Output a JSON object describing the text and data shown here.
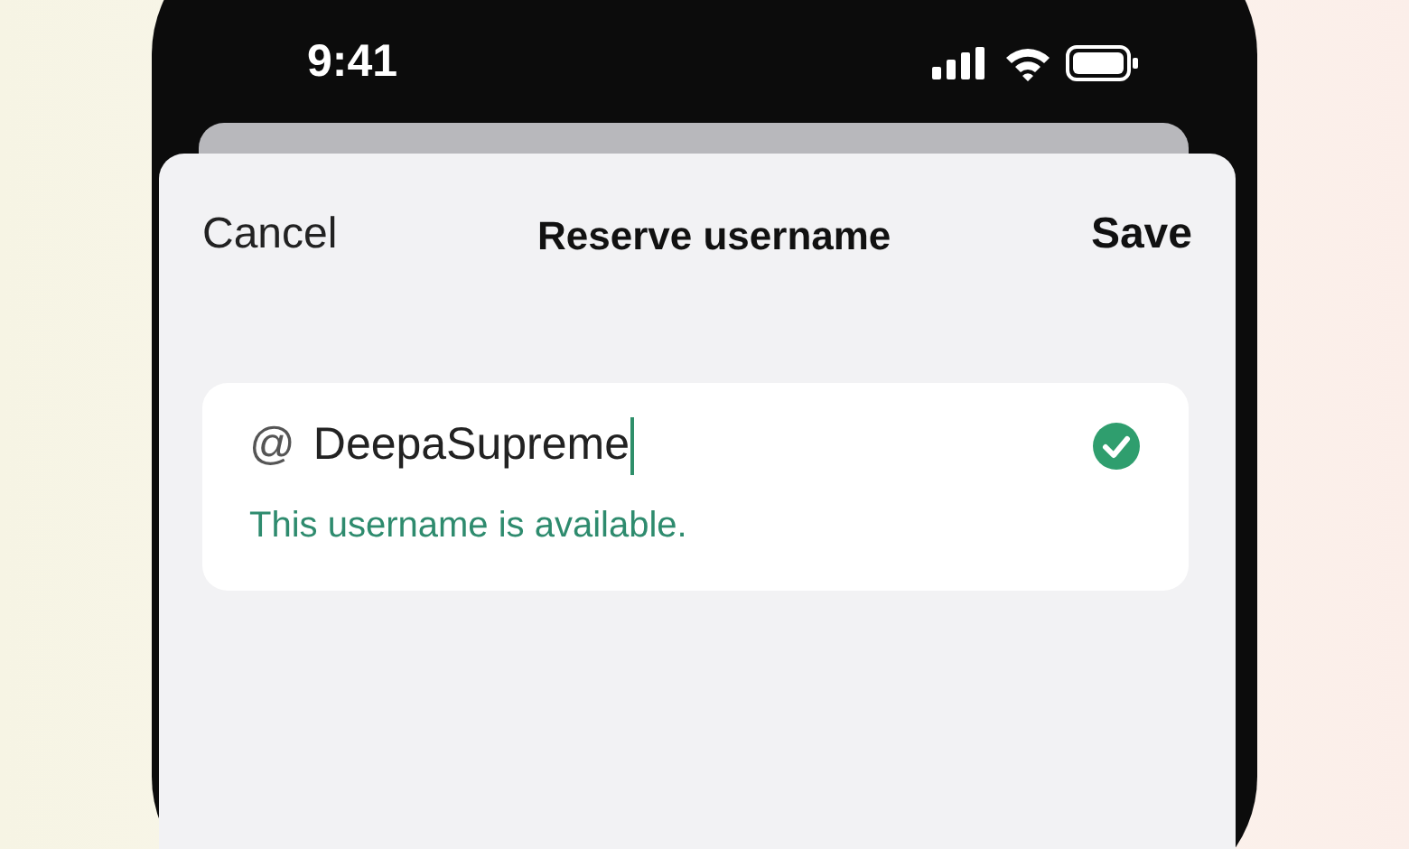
{
  "status_bar": {
    "time": "9:41"
  },
  "nav": {
    "cancel": "Cancel",
    "title": "Reserve username",
    "save": "Save"
  },
  "username_field": {
    "prefix": "@",
    "value": "DeepaSupreme",
    "valid": true,
    "message": "This username is available."
  }
}
